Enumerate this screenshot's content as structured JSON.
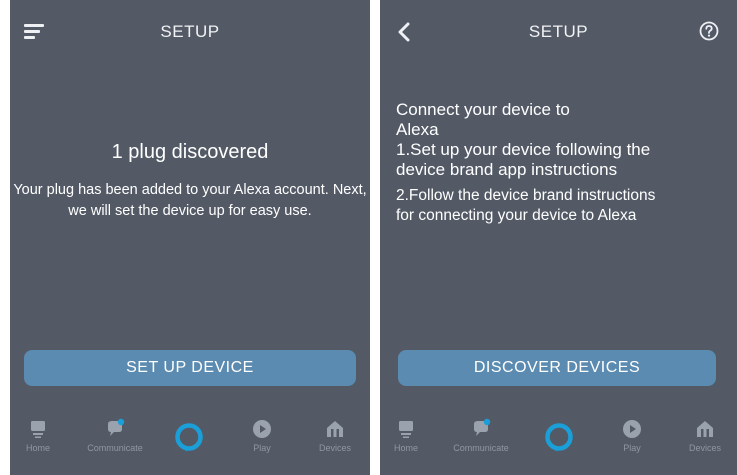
{
  "left_screen": {
    "title": "SETUP",
    "discovered_title": "1 plug discovered",
    "description": "Your plug has been added to your Alexa account. Next, we will set the device up for easy use.",
    "button_label": "SET UP DEVICE",
    "nav": [
      "Home",
      "Communicate",
      "Play",
      "Devices"
    ]
  },
  "right_screen": {
    "title": "SETUP",
    "heading_line1": "Connect your device to",
    "heading_line2": "Alexa",
    "step1_line1": "1.Set up your device following the",
    "step1_line2": "device brand app instructions",
    "step2_line1": "2.Follow the device brand instructions",
    "step2_line2": "for connecting your device to Alexa",
    "button_label": "DISCOVER DEVICES",
    "nav": [
      "Home",
      "Communicate",
      "Play",
      "Devices"
    ]
  },
  "icons": {
    "menu": "hamburger-menu-icon",
    "back": "back-arrow-icon",
    "help": "question-mark-icon",
    "home": "home-icon",
    "communicate": "chat-bubble-icon",
    "alexa": "alexa-ring-icon",
    "play": "play-icon",
    "devices": "devices-house-icon"
  },
  "colors": {
    "screen_background": "#535a66",
    "button": "#5b8bb0",
    "alexa_ring": "#1a9fd8",
    "nav_icon": "#9aa2ad"
  }
}
